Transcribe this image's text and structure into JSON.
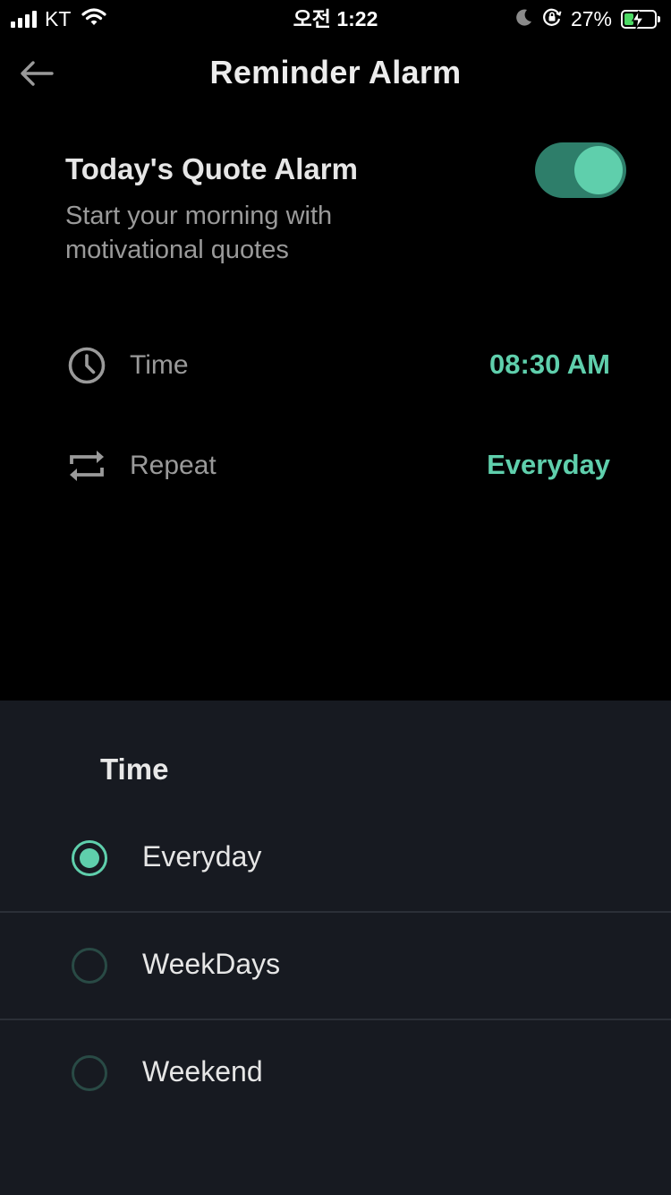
{
  "status_bar": {
    "carrier": "KT",
    "time": "오전 1:22",
    "battery_percent": "27%",
    "battery_level": 0.27,
    "icons": [
      "signal-icon",
      "wifi-icon",
      "moon-icon",
      "orientation-lock-icon",
      "battery-charging-icon"
    ]
  },
  "header": {
    "back_icon": "arrow-left-icon",
    "title": "Reminder Alarm"
  },
  "alarm": {
    "title": "Today's Quote Alarm",
    "description": "Start your morning with motivational quotes",
    "enabled": true
  },
  "settings": {
    "time": {
      "icon": "clock-icon",
      "label": "Time",
      "value": "08:30 AM"
    },
    "repeat": {
      "icon": "repeat-icon",
      "label": "Repeat",
      "value": "Everyday"
    }
  },
  "sheet": {
    "title": "Time",
    "options": [
      {
        "label": "Everyday",
        "selected": true
      },
      {
        "label": "WeekDays",
        "selected": false
      },
      {
        "label": "Weekend",
        "selected": false
      }
    ]
  },
  "colors": {
    "accent": "#5fcfac",
    "toggle_track": "#2e7e6a",
    "background": "#000000",
    "sheet_background": "#171a21",
    "muted_text": "#9a9a9a"
  }
}
